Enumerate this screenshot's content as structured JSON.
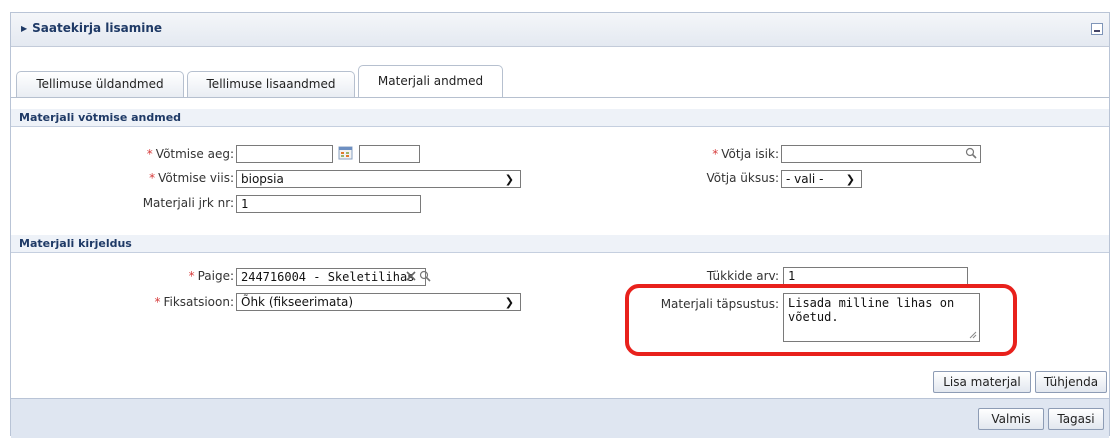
{
  "panel": {
    "title": "Saatekirja lisamine"
  },
  "tabs": [
    {
      "label": "Tellimuse üldandmed",
      "active": false
    },
    {
      "label": "Tellimuse lisaandmed",
      "active": false
    },
    {
      "label": "Materjali andmed",
      "active": true
    }
  ],
  "section_collection": {
    "title": "Materjali võtmise andmed",
    "time_label": "Võtmise aeg:",
    "time_date_value": "",
    "time_clock_value": "",
    "method_label": "Võtmise viis:",
    "method_value": "biopsia",
    "seq_label": "Materjali jrk nr:",
    "seq_value": "1",
    "taker_label": "Võtja isik:",
    "taker_value": "",
    "unit_label": "Võtja üksus:",
    "unit_value": "- vali -"
  },
  "section_description": {
    "title": "Materjali kirjeldus",
    "site_label": "Paige:",
    "site_value": "244716004 - Skeletilihas",
    "fixation_label": "Fiksatsioon:",
    "fixation_value": "Õhk (fikseerimata)",
    "pieces_label": "Tükkide arv:",
    "pieces_value": "1",
    "spec_label": "Materjali täpsustus:",
    "spec_value": "Lisada milline lihas on võetud."
  },
  "buttons": {
    "add_material": "Lisa materjal",
    "clear": "Tühjenda",
    "done": "Valmis",
    "back": "Tagasi"
  },
  "required_mark": "*",
  "colors": {
    "highlight": "#e8211c",
    "header_text": "#1f3a66",
    "required": "#d63b3b"
  }
}
